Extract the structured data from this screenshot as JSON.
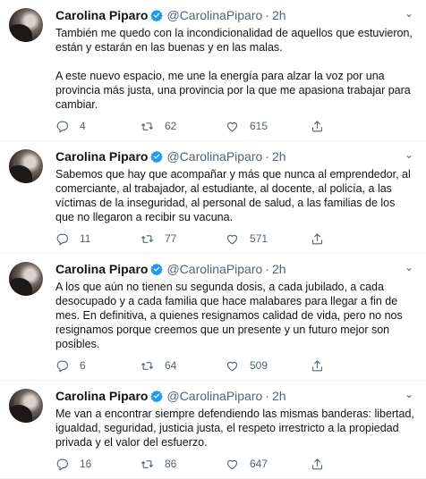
{
  "author": {
    "name": "Carolina Piparo",
    "handle": "@CarolinaPiparo",
    "separator": "·",
    "time": "2h"
  },
  "tweets": [
    {
      "paragraphs": [
        "También me quedo con la incondicionalidad de aquellos que estuvieron, están y estarán en las buenas y en las malas.",
        "A este nuevo espacio, me une la energía para alzar la voz por una provincia más justa, una provincia por la que me apasiona trabajar para cambiar."
      ],
      "replies": "4",
      "retweets": "62",
      "likes": "615"
    },
    {
      "paragraphs": [
        "Sabemos que hay que acompañar y más que nunca al emprendedor, al comerciante, al trabajador, al estudiante, al docente, al policía, a las víctimas de la inseguridad, al personal de salud, a las familias de los que no llegaron a recibir su vacuna."
      ],
      "replies": "11",
      "retweets": "77",
      "likes": "571"
    },
    {
      "paragraphs": [
        "A los que aún no tienen su segunda dosis, a cada jubilado, a cada desocupado y a cada familia que hace malabares para llegar a fin de mes. En definitiva, a quienes resignamos calidad de vida, pero no nos resignamos porque creemos que un presente y un futuro mejor son posibles."
      ],
      "replies": "6",
      "retweets": "64",
      "likes": "509"
    },
    {
      "paragraphs": [
        "Me van a encontrar siempre defendiendo las mismas banderas: libertad, igualdad, seguridad, justicia justa, el respeto irrestricto a la propiedad privada y el valor del esfuerzo."
      ],
      "replies": "16",
      "retweets": "86",
      "likes": "647"
    }
  ],
  "icons": {
    "reply": "reply-icon",
    "retweet": "retweet-icon",
    "like": "heart-icon",
    "share": "share-icon",
    "verified": "verified-badge-icon",
    "more": "chevron-down-icon"
  },
  "colors": {
    "text": "#0f1419",
    "secondary": "#536471",
    "verified": "#1d9bf0",
    "divider": "#eff3f4"
  }
}
